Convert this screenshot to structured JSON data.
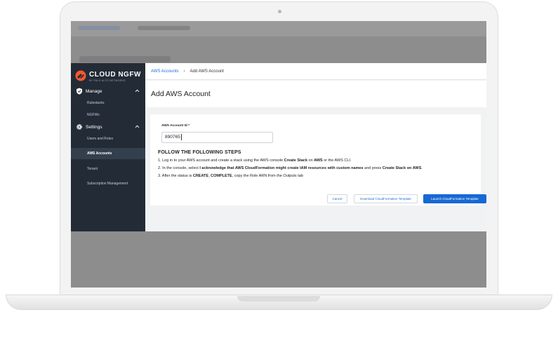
{
  "brand": {
    "name": "CLOUD NGFW",
    "tagline": "BY PALO ALTO NETWORKS",
    "accent": "#fa582d"
  },
  "sidebar": {
    "sections": [
      {
        "label": "Manage",
        "icon": "shield-icon",
        "items": [
          {
            "label": "Rulestacks"
          },
          {
            "label": "NGFWs"
          }
        ]
      },
      {
        "label": "Settings",
        "icon": "gear-icon",
        "items": [
          {
            "label": "Users and Roles"
          },
          {
            "label": "AWS Accounts",
            "active": true
          },
          {
            "label": "Tenant"
          },
          {
            "label": "Subscription Management"
          }
        ]
      }
    ]
  },
  "breadcrumb": {
    "parent": "AWS Accounts",
    "current": "Add AWS Account"
  },
  "page": {
    "title": "Add AWS Account"
  },
  "form": {
    "account_label": "AWS Account Id *",
    "account_value": "890765"
  },
  "steps": {
    "heading": "FOLLOW THE FOLLOWING STEPS",
    "step1": {
      "prefix": "1. Log in to your AWS account and create a stack using the AWS console ",
      "bold1": "Create Stack",
      "mid": " on ",
      "bold2": "AWS",
      "suffix": " or the AWS CLI."
    },
    "step2": {
      "prefix": "2. In the console, select ",
      "bold1": "I acknowledge that AWS CloudFormation might create IAM resources with custom names",
      "mid": " and press ",
      "bold2": "Create Stack on AWS",
      "suffix": "."
    },
    "step3": {
      "prefix": "3. After the status is ",
      "bold1": "CREATE_COMPLETE",
      "suffix": ", copy the Role ARN from the Outputs tab"
    }
  },
  "actions": {
    "cancel": "Cancel",
    "download": "Download CloudFormation Template",
    "launch": "Launch CloudFormation Template"
  },
  "colors": {
    "sidebar_bg": "#232b36",
    "primary": "#1669d4",
    "link": "#1e6bd6"
  }
}
